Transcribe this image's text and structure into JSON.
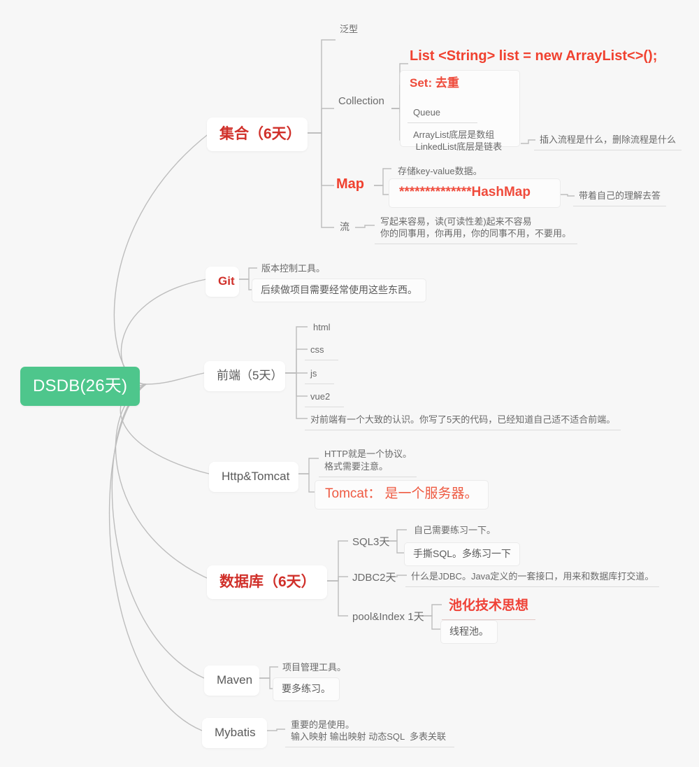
{
  "meta": {
    "background": "#f7f7f7",
    "accent_green": "#4ec68c",
    "accent_red": "#d0302a",
    "accent_orange_red": "#ef4136",
    "link_color": "#bdbdbd"
  },
  "root": {
    "label": "DSDB(26天)"
  },
  "branches": [
    {
      "key": "collection",
      "label": "集合（6天）",
      "children": {
        "generic": "泛型",
        "collection": "Collection",
        "collection_children": {
          "list": "List <String> list = new ArrayList<>();",
          "set": "Set: 去重",
          "queue": "Queue",
          "impl_line1": "ArrayList底层是数组",
          "impl_line2": " LinkedList底层是链表",
          "impl_note": "插入流程是什么，删除流程是什么"
        },
        "map": "Map",
        "map_children": {
          "kv": "存储key-value数据。",
          "hashmap": "**************HashMap",
          "hashmap_note": "带着自己的理解去答"
        },
        "stream": "流",
        "stream_children": {
          "line1": "写起来容易，读(可读性差)起来不容易",
          "line2": "你的同事用，你再用，你的同事不用，不要用。"
        }
      }
    },
    {
      "key": "git",
      "label": "Git",
      "children": {
        "desc": "版本控制工具。",
        "note": "后续做项目需要经常使用这些东西。"
      }
    },
    {
      "key": "frontend",
      "label": "前端（5天）",
      "children": {
        "html": "html",
        "css": "css",
        "js": "js",
        "vue2": "vue2",
        "summary": "对前端有一个大致的认识。你写了5天的代码，已经知道自己适不适合前端。"
      }
    },
    {
      "key": "http_tomcat",
      "label": "Http&Tomcat",
      "children": {
        "line1": "HTTP就是一个协议。",
        "line2": "格式需要注意。",
        "tomcat": "Tomcat： 是一个服务器。"
      }
    },
    {
      "key": "database",
      "label": "数据库（6天）",
      "children": {
        "sql": "SQL3天",
        "sql_note_top": "自己需要练习一下。",
        "sql_note_box": "手撕SQL。多练习一下",
        "jdbc": "JDBC2天",
        "jdbc_note": "什么是JDBC。Java定义的一套接口，用来和数据库打交道。",
        "pool": "pool&Index 1天",
        "pool_note_top": "池化技术思想",
        "pool_note_box": "线程池。"
      }
    },
    {
      "key": "maven",
      "label": "Maven",
      "children": {
        "desc": "项目管理工具。",
        "note": "要多练习。"
      }
    },
    {
      "key": "mybatis",
      "label": "Mybatis",
      "children": {
        "line1": "重要的是使用。",
        "line2": "输入映射 输出映射 动态SQL  多表关联"
      }
    }
  ]
}
